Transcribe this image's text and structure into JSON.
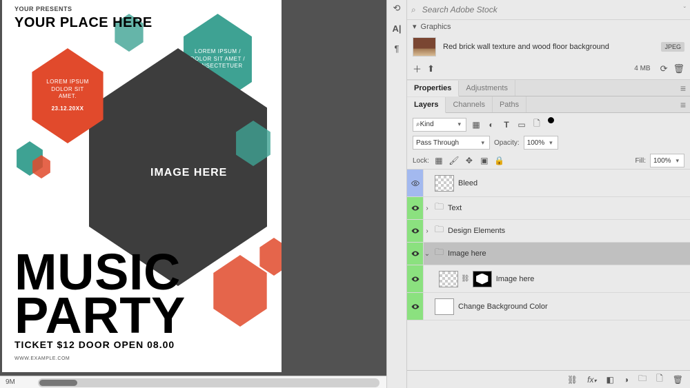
{
  "document": {
    "presents": "YOUR PRESENTS",
    "place_here": "YOUR PLACE HERE",
    "image_here": "IMAGE HERE",
    "title1": "MUSIC",
    "title2": "PARTY",
    "ticket": "TICKET $12 DOOR OPEN 08.00",
    "url": "WWW.EXAMPLE.COM",
    "red_hex_l1": "LOREM IPSUM",
    "red_hex_l2": "DOLOR SIT",
    "red_hex_l3": "AMET.",
    "red_hex_date": "23.12.20XX",
    "teal_hex_l1": "LOREM IPSUM /",
    "teal_hex_l2": "DOLOR SIT AMET /",
    "teal_hex_l3": "CONSECTETUER"
  },
  "status_bar": {
    "zoom": "9M"
  },
  "mid_tools": {
    "t0": "⟲",
    "t1": "A|",
    "t2": "¶"
  },
  "search": {
    "placeholder": "Search Adobe Stock"
  },
  "graphics": {
    "heading": "Graphics",
    "item_label": "Red brick wall texture and wood floor background",
    "item_tag": "JPEG",
    "filesize": "4 MB"
  },
  "tabs": {
    "properties": "Properties",
    "adjustments": "Adjustments",
    "layers": "Layers",
    "channels": "Channels",
    "paths": "Paths"
  },
  "layer_ctrls": {
    "kind_prefix": "⌕",
    "kind_label": "Kind",
    "blend_mode": "Pass Through",
    "opacity_label": "Opacity:",
    "opacity_value": "100%",
    "lock_label": "Lock:",
    "fill_label": "Fill:",
    "fill_value": "100%"
  },
  "layers": {
    "bleed": "Bleed",
    "text": "Text",
    "design": "Design Elements",
    "image_group": "Image here",
    "image_layer": "Image here",
    "bg": "Change Background Color"
  }
}
